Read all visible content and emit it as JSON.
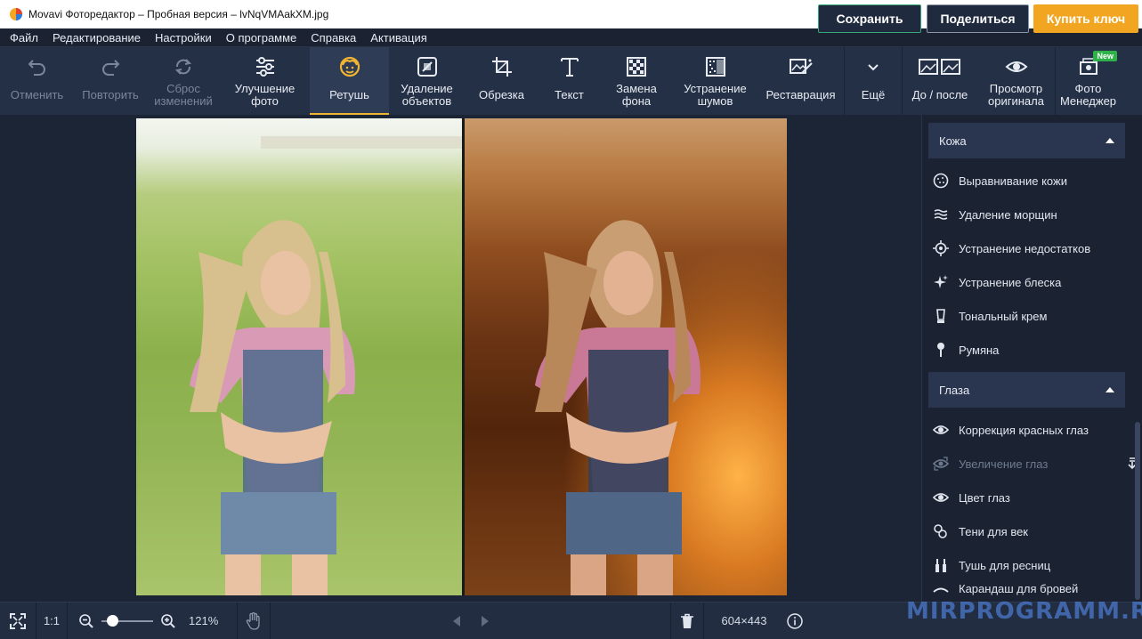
{
  "window": {
    "title": "Movavi Фоторедактор – Пробная версия – lvNqVMAakXM.jpg"
  },
  "menu": [
    "Файл",
    "Редактирование",
    "Настройки",
    "О программе",
    "Справка",
    "Активация"
  ],
  "toolbar": {
    "undo": "Отменить",
    "redo": "Повторить",
    "reset_1": "Сброс",
    "reset_2": "изменений",
    "enhance_1": "Улучшение",
    "enhance_2": "фото",
    "retouch": "Ретушь",
    "remove_1": "Удаление",
    "remove_2": "объектов",
    "crop": "Обрезка",
    "text": "Текст",
    "bg_1": "Замена",
    "bg_2": "фона",
    "noise_1": "Устранение",
    "noise_2": "шумов",
    "restore": "Реставрация",
    "more": "Ещё",
    "before_after": "До / после",
    "view_orig_1": "Просмотр",
    "view_orig_2": "оригинала",
    "photo_mgr_1": "Фото",
    "photo_mgr_2": "Менеджер",
    "new_badge": "New"
  },
  "panel": {
    "skin_section": "Кожа",
    "skin_items": [
      "Выравнивание кожи",
      "Удаление морщин",
      "Устранение недостатков",
      "Устранение блеска",
      "Тональный крем",
      "Румяна"
    ],
    "eyes_section": "Глаза",
    "eyes_items": [
      "Коррекция красных глаз",
      "Увеличение глаз",
      "Цвет глаз",
      "Тени для век",
      "Тушь для ресниц",
      "Карандаш для бровей"
    ]
  },
  "status": {
    "one_to_one": "1:1",
    "zoom": "121%",
    "dimensions": "604×443",
    "save": "Сохранить",
    "share": "Поделиться",
    "buy": "Купить ключ"
  },
  "watermark": "MIRPROGRAMM.RU"
}
